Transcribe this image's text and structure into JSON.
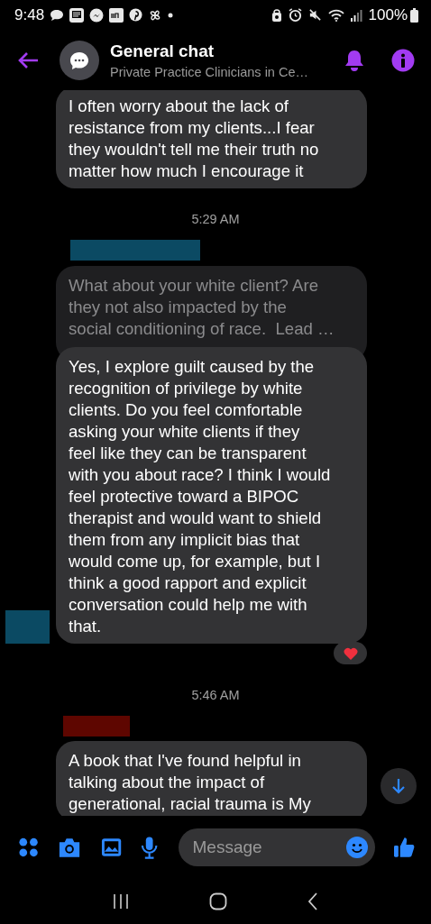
{
  "status_bar": {
    "time": "9:48",
    "battery": "100%"
  },
  "header": {
    "title": "General chat",
    "subtitle": "Private Practice Clinicians in Ce…"
  },
  "thread": [
    {
      "kind": "message",
      "text": "I often worry about the lack of\nresistance from my clients...I fear\nthey wouldn't tell me their truth no\nmatter how much I encourage it",
      "reacted": false
    },
    {
      "kind": "timestamp",
      "text": "5:29 AM"
    },
    {
      "kind": "sender",
      "color": "#0b4a63"
    },
    {
      "kind": "quote",
      "text": "What about your white client? Are\nthey not also impacted by the\nsocial conditioning of race.  Lead …"
    },
    {
      "kind": "message",
      "text": "Yes, I explore guilt caused by the\nrecognition of privilege by white\nclients. Do you feel comfortable\nasking your white clients if they\nfeel like they can be transparent\nwith you about race? I think I would\nfeel protective toward a BIPOC\ntherapist and would want to shield\nthem from any implicit bias that\nwould come up, for example, but I\nthink a good rapport and explicit\nconversation could help me with\nthat.",
      "reacted": true,
      "avatar": {
        "color": "#0b4a63"
      }
    },
    {
      "kind": "timestamp",
      "text": "5:46 AM"
    },
    {
      "kind": "sender",
      "color": "#5e0600"
    },
    {
      "kind": "message",
      "text": "A book that I've found helpful in\ntalking about the impact of\ngenerational, racial trauma is My",
      "reacted": false
    }
  ],
  "composer": {
    "placeholder": "Message"
  }
}
